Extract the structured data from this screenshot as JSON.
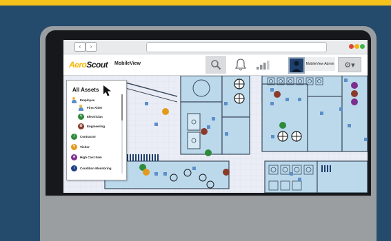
{
  "app": {
    "logo_part1": "Aero",
    "logo_part2": "Scout",
    "product": "MobileView",
    "user_label": "MobileView Admin",
    "back_icon": "chevron-left-icon",
    "forward_icon": "chevron-right-icon",
    "search_icon": "search-icon",
    "bell_icon": "bell-icon",
    "signal_icon": "signal-icon",
    "gear_icon": "gear-icon"
  },
  "legend": {
    "title": "All Assets",
    "items": [
      {
        "label": "Employee",
        "icon": "person-icon",
        "level": 0
      },
      {
        "label": "First Aider",
        "icon": "person-icon",
        "level": 1
      },
      {
        "label": "Electrician",
        "icon": "lightning-icon",
        "level": 1,
        "color": "#2f8a3c"
      },
      {
        "label": "Engineering",
        "icon": "gear-icon",
        "level": 1,
        "color": "#8a3b2a"
      },
      {
        "label": "Contractor",
        "icon": "wrench-icon",
        "level": 0,
        "color": "#2f8a3c"
      },
      {
        "label": "Visitor",
        "icon": "visitor-icon",
        "level": 0,
        "color": "#e39a1a",
        "glyph": "V"
      },
      {
        "label": "High Cost Item",
        "icon": "star-icon",
        "level": 0,
        "color": "#7b2f8c"
      },
      {
        "label": "Condition Monitoring",
        "icon": "info-icon",
        "level": 0,
        "color": "#1f3f8a",
        "glyph": "i"
      }
    ]
  },
  "colors": {
    "brand_yellow": "#f4c21b",
    "background": "#244a6c",
    "room_fill": "#bcd9ec",
    "room_stroke": "#3a4a5a"
  }
}
